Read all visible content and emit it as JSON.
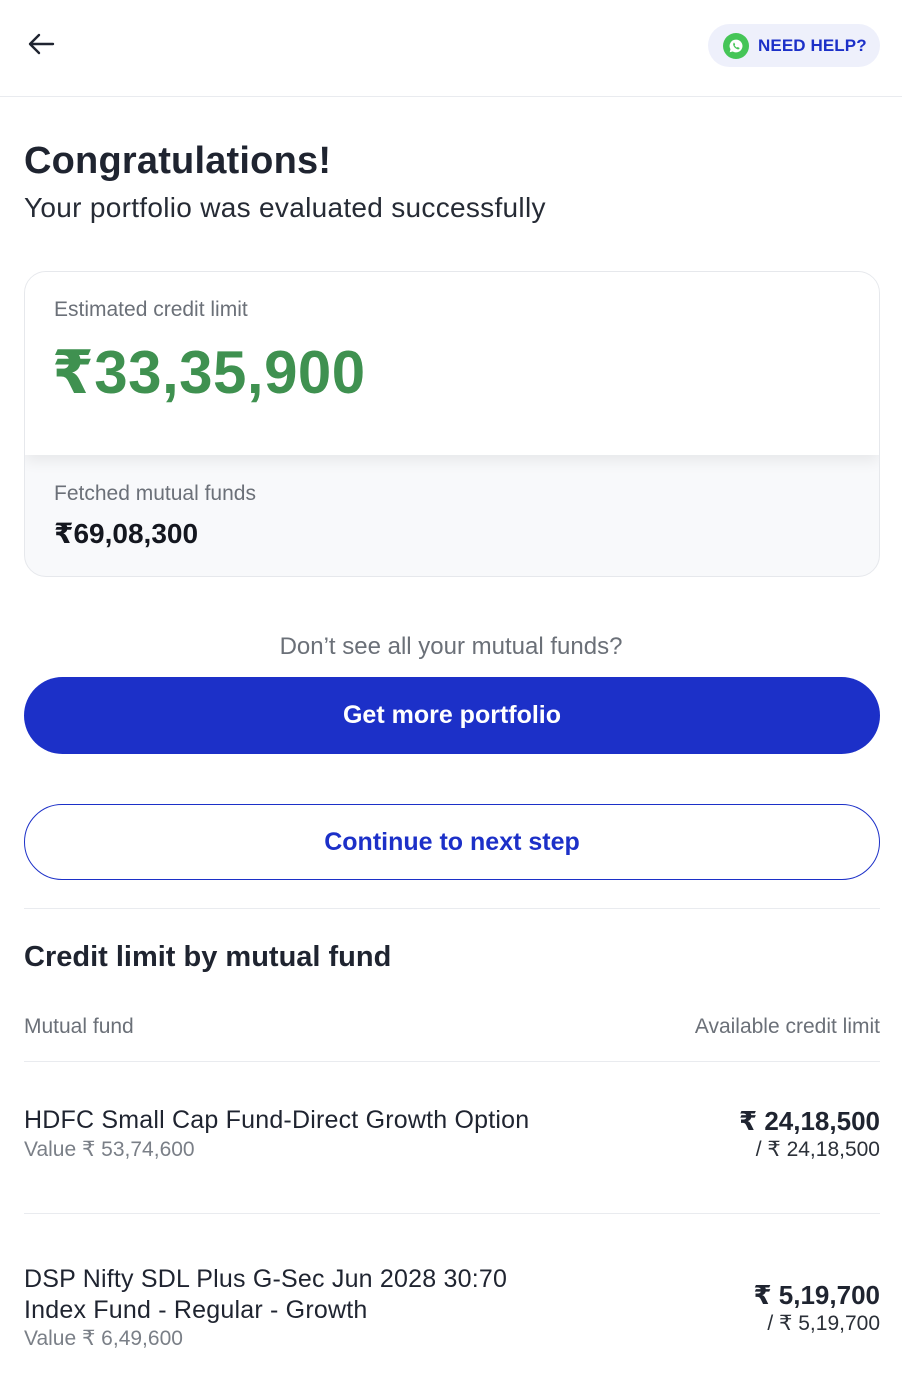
{
  "header": {
    "back_icon": "arrow-left-icon",
    "help_icon": "whatsapp-icon",
    "help_label": "NEED HELP?",
    "accent_color": "#1c30c8"
  },
  "hero": {
    "title": "Congratulations!",
    "subtitle": "Your portfolio was evaluated successfully"
  },
  "summary": {
    "estimated_label": "Estimated credit limit",
    "estimated_value": "₹33,35,900",
    "estimated_color": "#3f9150",
    "fetched_label": "Fetched mutual funds",
    "fetched_value": "₹69,08,300"
  },
  "actions": {
    "prompt": "Don’t see all your mutual funds?",
    "primary_label": "Get more portfolio",
    "secondary_label": "Continue to next step"
  },
  "breakdown": {
    "title": "Credit limit by mutual fund",
    "col_fund": "Mutual fund",
    "col_limit": "Available credit limit",
    "funds": [
      {
        "name_line1": "HDFC Small Cap Fund-Direct Growth Option",
        "name_line2": "",
        "value": "Value ₹ 53,74,600",
        "limit": "₹ 24,18,500",
        "limit_of": "/ ₹ 24,18,500"
      },
      {
        "name_line1": "DSP Nifty SDL Plus G-Sec Jun 2028 30:70",
        "name_line2": "Index Fund - Regular - Growth",
        "value": "Value ₹ 6,49,600",
        "limit": "₹ 5,19,700",
        "limit_of": "/ ₹ 5,19,700"
      }
    ]
  }
}
